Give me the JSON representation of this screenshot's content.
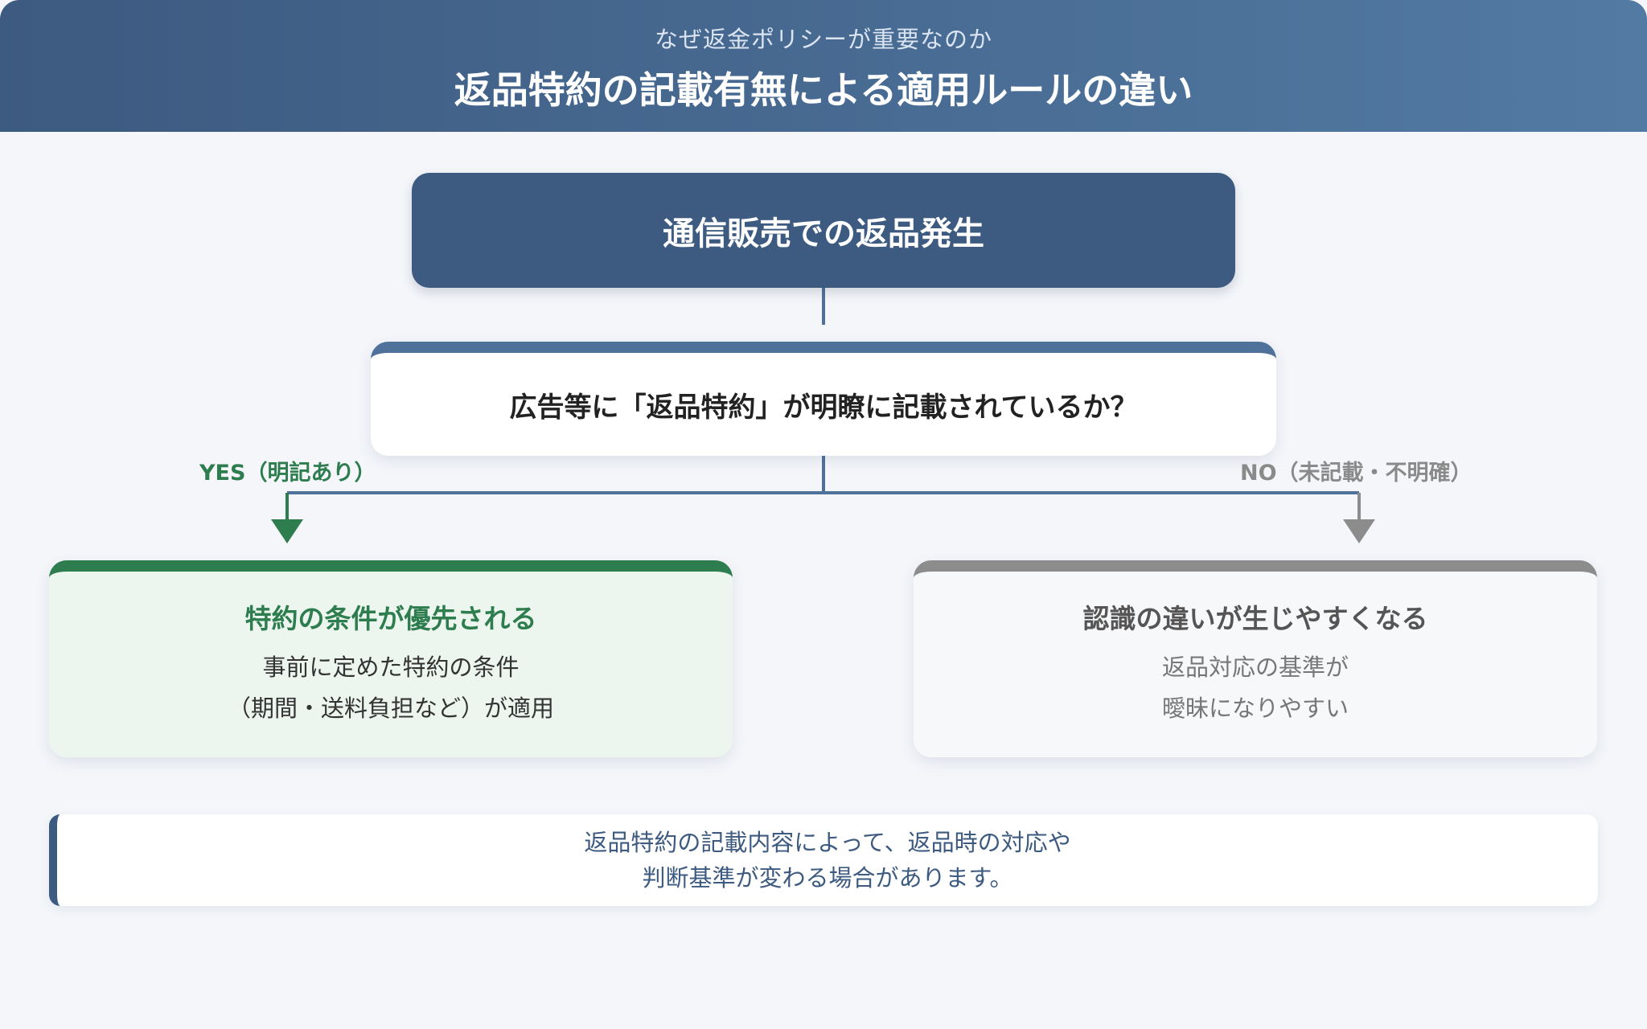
{
  "header": {
    "subtitle": "なぜ返金ポリシーが重要なのか",
    "title": "返品特約の記載有無による適用ルールの違い"
  },
  "flow": {
    "start": "通信販売での返品発生",
    "question": "広告等に「返品特約」が明瞭に記載されているか？",
    "yes_label": "YES（明記あり）",
    "no_label": "NO（未記載・不明確）",
    "yes_result": {
      "title": "特約の条件が優先される",
      "lines": [
        "事前に定めた特約の条件",
        "（期間・送料負担など）が適用"
      ]
    },
    "no_result": {
      "title": "認識の違いが生じやすくなる",
      "lines": [
        "返品対応の基準が",
        "曖昧になりやすい"
      ]
    }
  },
  "note": {
    "lines": [
      "返品特約の記載内容によって、返品時の対応や",
      "判断基準が変わる場合があります。"
    ]
  },
  "colors": {
    "primary": "#3d5a80",
    "connector": "#4f729a",
    "yes": "#2e7d4f",
    "no": "#8c8c8c"
  }
}
